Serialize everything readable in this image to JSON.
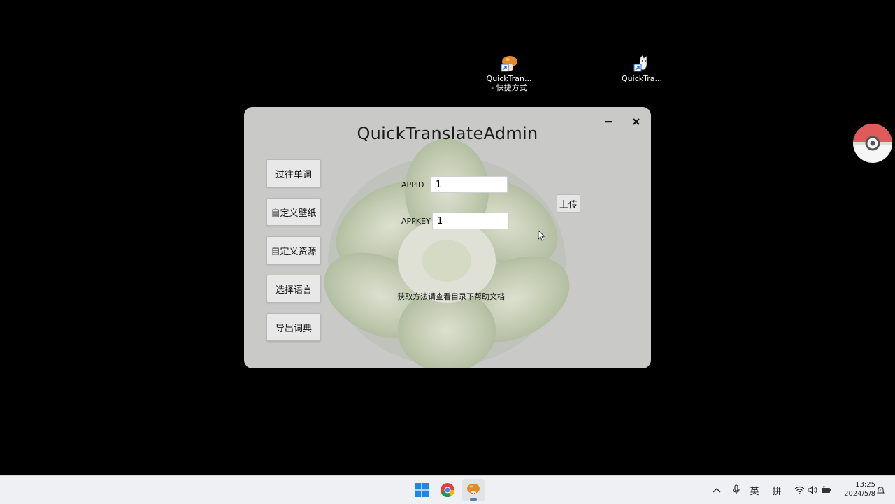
{
  "desktop": {
    "icons": [
      {
        "label_line1": "QuickTran...",
        "label_line2": "- 快捷方式",
        "icon": "mushroom-shortcut-icon"
      },
      {
        "label_line1": "QuickTra...",
        "label_line2": "",
        "icon": "cat-shortcut-icon"
      }
    ]
  },
  "window": {
    "title": "QuickTranslateAdmin",
    "sidebar": [
      {
        "label": "过往单词"
      },
      {
        "label": "自定义壁纸"
      },
      {
        "label": "自定义资源"
      },
      {
        "label": "选择语言"
      },
      {
        "label": "导出词典"
      }
    ],
    "form": {
      "appid_label": "APPID",
      "appid_value": "1",
      "appkey_label": "APPKEY",
      "appkey_value": "1",
      "upload_label": "上传",
      "help_text": "获取方法请查看目录下帮助文档"
    }
  },
  "taskbar": {
    "tray": {
      "ime_lang": "英",
      "ime_mode": "拼"
    },
    "clock": {
      "time": "13:25",
      "date": "2024/5/8"
    }
  },
  "colors": {
    "window_bg": "#c9cac8",
    "taskbar_bg": "#eef0f3",
    "accent": "#5a7bb0"
  }
}
